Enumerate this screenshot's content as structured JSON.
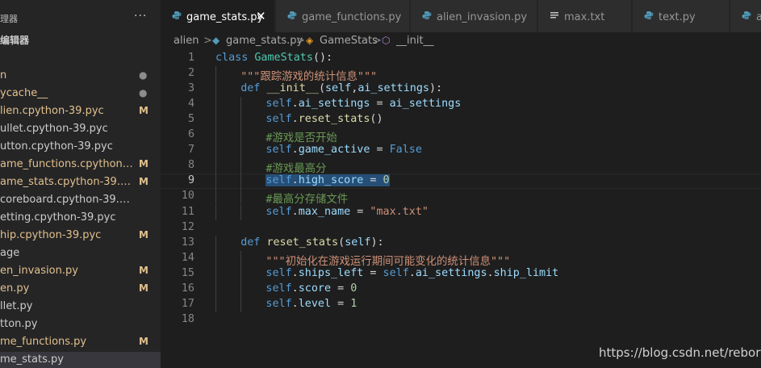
{
  "sidebar": {
    "header_title": "理器",
    "more_icon": "more-dots-icon",
    "section_title": "编辑器",
    "files": [
      {
        "name": "n",
        "badge": "●",
        "color": "#e2c08d",
        "badge_color": "#8c8c8c"
      },
      {
        "name": "ycache__",
        "badge": "●",
        "color": "#e2c08d",
        "badge_color": "#8c8c8c"
      },
      {
        "name": "lien.cpython-39.pyc",
        "badge": "M",
        "color": "#e2c08d",
        "badge_color": "#e2c08d"
      },
      {
        "name": "ullet.cpython-39.pyc",
        "badge": "",
        "color": "#cccccc",
        "badge_color": "#cccccc"
      },
      {
        "name": "utton.cpython-39.pyc",
        "badge": "",
        "color": "#cccccc",
        "badge_color": "#cccccc"
      },
      {
        "name": "ame_functions.cpython-39....",
        "badge": "M",
        "color": "#e2c08d",
        "badge_color": "#e2c08d"
      },
      {
        "name": "ame_stats.cpython-39.pyc",
        "badge": "M",
        "color": "#e2c08d",
        "badge_color": "#e2c08d"
      },
      {
        "name": "coreboard.cpython-39.pyc",
        "badge": "",
        "color": "#cccccc",
        "badge_color": "#cccccc"
      },
      {
        "name": "etting.cpython-39.pyc",
        "badge": "",
        "color": "#cccccc",
        "badge_color": "#cccccc"
      },
      {
        "name": "hip.cpython-39.pyc",
        "badge": "M",
        "color": "#e2c08d",
        "badge_color": "#e2c08d"
      },
      {
        "name": "age",
        "badge": "",
        "color": "#cccccc",
        "badge_color": "#cccccc"
      },
      {
        "name": "en_invasion.py",
        "badge": "M",
        "color": "#e2c08d",
        "badge_color": "#e2c08d"
      },
      {
        "name": "en.py",
        "badge": "M",
        "color": "#e2c08d",
        "badge_color": "#e2c08d"
      },
      {
        "name": "llet.py",
        "badge": "",
        "color": "#cccccc",
        "badge_color": "#cccccc"
      },
      {
        "name": "tton.py",
        "badge": "",
        "color": "#cccccc",
        "badge_color": "#cccccc"
      },
      {
        "name": "me_functions.py",
        "badge": "M",
        "color": "#e2c08d",
        "badge_color": "#e2c08d"
      },
      {
        "name": "me_stats.py",
        "badge": "",
        "color": "#cccccc",
        "badge_color": "#cccccc",
        "selected": true
      }
    ]
  },
  "tabs": [
    {
      "label": "game_stats.py",
      "icon": "python-icon",
      "active": true,
      "close": "✕"
    },
    {
      "label": "game_functions.py",
      "icon": "python-icon",
      "active": false
    },
    {
      "label": "alien_invasion.py",
      "icon": "python-icon",
      "active": false
    },
    {
      "label": "max.txt",
      "icon": "text-file-icon",
      "active": false
    },
    {
      "label": "text.py",
      "icon": "python-icon",
      "active": false
    },
    {
      "label": "a",
      "icon": "python-icon",
      "active": false
    }
  ],
  "breadcrumb": {
    "folder": "alien",
    "sep": ">",
    "file": "game_stats.py",
    "class_name": "GameStats",
    "method": "__init__"
  },
  "editor": {
    "current_line": 9,
    "lines": [
      {
        "n": "1",
        "indent": 0,
        "tokens": [
          [
            "kw",
            "class "
          ],
          [
            "cls",
            "GameStats"
          ],
          [
            "pl",
            "():"
          ]
        ]
      },
      {
        "n": "2",
        "indent": 1,
        "tokens": [
          [
            "str",
            "\"\"\"跟踪游戏的统计信息\"\"\""
          ]
        ]
      },
      {
        "n": "3",
        "indent": 1,
        "tokens": [
          [
            "kw",
            "def "
          ],
          [
            "fn",
            "__init__"
          ],
          [
            "pl",
            "("
          ],
          [
            "var",
            "self"
          ],
          [
            "pl",
            ","
          ],
          [
            "var",
            "ai_settings"
          ],
          [
            "pl",
            "):"
          ]
        ]
      },
      {
        "n": "4",
        "indent": 2,
        "tokens": [
          [
            "kw",
            "self"
          ],
          [
            "pl",
            "."
          ],
          [
            "var",
            "ai_settings"
          ],
          [
            "pl",
            " = "
          ],
          [
            "var",
            "ai_settings"
          ]
        ]
      },
      {
        "n": "5",
        "indent": 2,
        "tokens": [
          [
            "kw",
            "self"
          ],
          [
            "pl",
            "."
          ],
          [
            "fn",
            "reset_stats"
          ],
          [
            "pl",
            "()"
          ]
        ]
      },
      {
        "n": "6",
        "indent": 2,
        "tokens": [
          [
            "cmt",
            "#游戏是否开始"
          ]
        ]
      },
      {
        "n": "7",
        "indent": 2,
        "tokens": [
          [
            "kw",
            "self"
          ],
          [
            "pl",
            "."
          ],
          [
            "var",
            "game_active"
          ],
          [
            "pl",
            " = "
          ],
          [
            "kw",
            "False"
          ]
        ]
      },
      {
        "n": "8",
        "indent": 2,
        "tokens": [
          [
            "cmt",
            "#游戏最高分"
          ]
        ]
      },
      {
        "n": "9",
        "indent": 2,
        "tokens": [
          [
            "kw sel",
            "self"
          ],
          [
            "pl sel",
            "."
          ],
          [
            "var sel",
            "high_score"
          ],
          [
            "pl sel",
            " = "
          ],
          [
            "num sel",
            "0"
          ]
        ]
      },
      {
        "n": "10",
        "indent": 2,
        "tokens": [
          [
            "cmt",
            "#最高分存储文件"
          ]
        ]
      },
      {
        "n": "11",
        "indent": 2,
        "tokens": [
          [
            "kw",
            "self"
          ],
          [
            "pl",
            "."
          ],
          [
            "var",
            "max_name"
          ],
          [
            "pl",
            " = "
          ],
          [
            "str",
            "\"max.txt\""
          ]
        ]
      },
      {
        "n": "12",
        "indent": 0,
        "tokens": []
      },
      {
        "n": "13",
        "indent": 1,
        "tokens": [
          [
            "kw",
            "def "
          ],
          [
            "fn",
            "reset_stats"
          ],
          [
            "pl",
            "("
          ],
          [
            "var",
            "self"
          ],
          [
            "pl",
            "):"
          ]
        ]
      },
      {
        "n": "14",
        "indent": 2,
        "tokens": [
          [
            "str",
            "\"\"\"初始化在游戏运行期间可能变化的统计信息\"\"\""
          ]
        ]
      },
      {
        "n": "15",
        "indent": 2,
        "tokens": [
          [
            "kw",
            "self"
          ],
          [
            "pl",
            "."
          ],
          [
            "var",
            "ships_left"
          ],
          [
            "pl",
            " = "
          ],
          [
            "kw",
            "self"
          ],
          [
            "pl",
            "."
          ],
          [
            "var",
            "ai_settings"
          ],
          [
            "pl",
            "."
          ],
          [
            "var",
            "ship_limit"
          ]
        ]
      },
      {
        "n": "16",
        "indent": 2,
        "tokens": [
          [
            "kw",
            "self"
          ],
          [
            "pl",
            "."
          ],
          [
            "var",
            "score"
          ],
          [
            "pl",
            " = "
          ],
          [
            "num",
            "0"
          ]
        ]
      },
      {
        "n": "17",
        "indent": 2,
        "tokens": [
          [
            "kw",
            "self"
          ],
          [
            "pl",
            "."
          ],
          [
            "var",
            "level"
          ],
          [
            "pl",
            " = "
          ],
          [
            "num",
            "1"
          ]
        ]
      },
      {
        "n": "18",
        "indent": 0,
        "tokens": []
      }
    ]
  },
  "watermark": "https://blog.csdn.net/rebortt"
}
